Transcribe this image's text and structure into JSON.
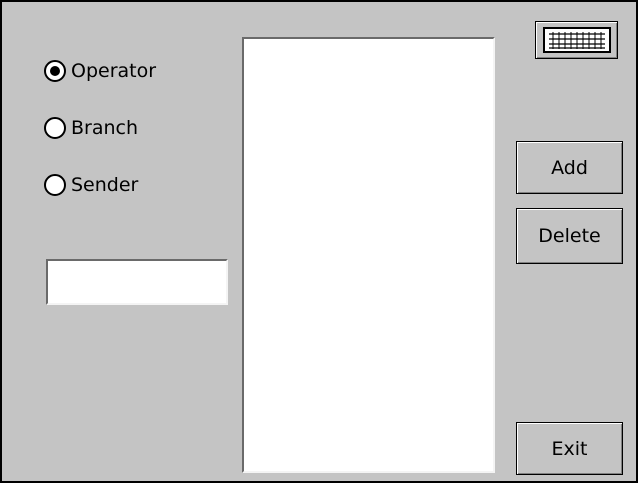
{
  "radio_group": {
    "options": [
      {
        "label": "Operator",
        "selected": true
      },
      {
        "label": "Branch",
        "selected": false
      },
      {
        "label": "Sender",
        "selected": false
      }
    ]
  },
  "text_field": {
    "value": "",
    "placeholder": ""
  },
  "list": {
    "items": []
  },
  "buttons": {
    "add": "Add",
    "delete": "Delete",
    "exit": "Exit"
  },
  "icons": {
    "keyboard": "keyboard-icon"
  }
}
